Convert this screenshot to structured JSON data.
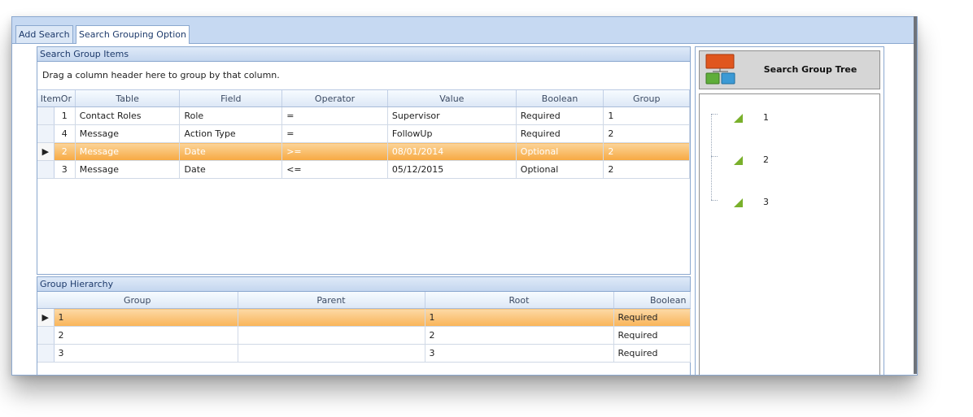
{
  "tabs": [
    {
      "label": "Add Search",
      "active": false
    },
    {
      "label": "Search Grouping Option",
      "active": true
    }
  ],
  "search_group_items": {
    "title": "Search Group Items",
    "group_prompt": "Drag a column header here to group by that column.",
    "columns": [
      "ItemOr",
      "Table",
      "Field",
      "Operator",
      "Value",
      "Boolean",
      "Group"
    ],
    "rows": [
      {
        "item": "1",
        "table": "Contact Roles",
        "field": "Role",
        "operator": "=",
        "value": "Supervisor",
        "boolean": "Required",
        "group": "1",
        "selected": false
      },
      {
        "item": "4",
        "table": "Message",
        "field": "Action Type",
        "operator": "=",
        "value": "FollowUp",
        "boolean": "Required",
        "group": "2",
        "selected": false
      },
      {
        "item": "2",
        "table": "Message",
        "field": "Date",
        "operator": ">=",
        "value": "08/01/2014",
        "boolean": "Optional",
        "group": "2",
        "selected": true
      },
      {
        "item": "3",
        "table": "Message",
        "field": "Date",
        "operator": "<=",
        "value": "05/12/2015",
        "boolean": "Optional",
        "group": "2",
        "selected": false
      }
    ]
  },
  "group_hierarchy": {
    "title": "Group Hierarchy",
    "columns": [
      "Group",
      "Parent",
      "Root",
      "Boolean"
    ],
    "rows": [
      {
        "group": "1",
        "parent": "",
        "root": "1",
        "boolean": "Required",
        "selected": true
      },
      {
        "group": "2",
        "parent": "",
        "root": "2",
        "boolean": "Required",
        "selected": false
      },
      {
        "group": "3",
        "parent": "",
        "root": "3",
        "boolean": "Required",
        "selected": false
      }
    ]
  },
  "tree": {
    "button_label": "Search Group Tree",
    "nodes": [
      "1",
      "2",
      "3"
    ],
    "icon_name": "hierarchy-icon",
    "node_icon_name": "triangle-node-icon"
  },
  "colors": {
    "accent": "#c6d9f2",
    "selection": "#f7a941",
    "node_icon": "#79b02b",
    "tree_icon_top": "#e0561e",
    "tree_icon_left": "#5fae3a",
    "tree_icon_right": "#3c9ad5"
  }
}
